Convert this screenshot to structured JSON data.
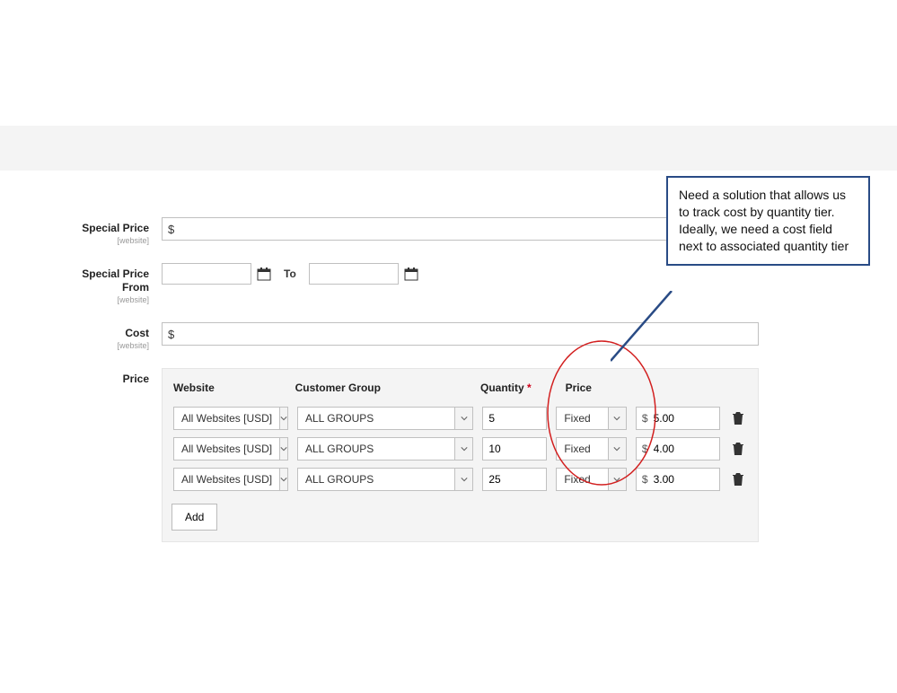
{
  "labels": {
    "special_price": "Special Price",
    "special_price_scope": "[website]",
    "special_price_from": "Special Price From",
    "special_price_from_scope": "[website]",
    "to": "To",
    "cost": "Cost",
    "cost_scope": "[website]",
    "price": "Price"
  },
  "table": {
    "headers": {
      "website": "Website",
      "customer_group": "Customer Group",
      "quantity": "Quantity",
      "price": "Price"
    },
    "currency": "$",
    "rows": [
      {
        "website": "All Websites [USD]",
        "group": "ALL GROUPS",
        "qty": "5",
        "price_type": "Fixed",
        "amount": "5.00"
      },
      {
        "website": "All Websites [USD]",
        "group": "ALL GROUPS",
        "qty": "10",
        "price_type": "Fixed",
        "amount": "4.00"
      },
      {
        "website": "All Websites [USD]",
        "group": "ALL GROUPS",
        "qty": "25",
        "price_type": "Fixed",
        "amount": "3.00"
      }
    ],
    "add": "Add"
  },
  "annotation": {
    "text": "Need a solution that allows us to track cost by quantity tier. Ideally, we need a cost field next to associated quantity tier"
  },
  "fields": {
    "special_price": "",
    "cost": "",
    "date_from": "",
    "date_to": ""
  }
}
